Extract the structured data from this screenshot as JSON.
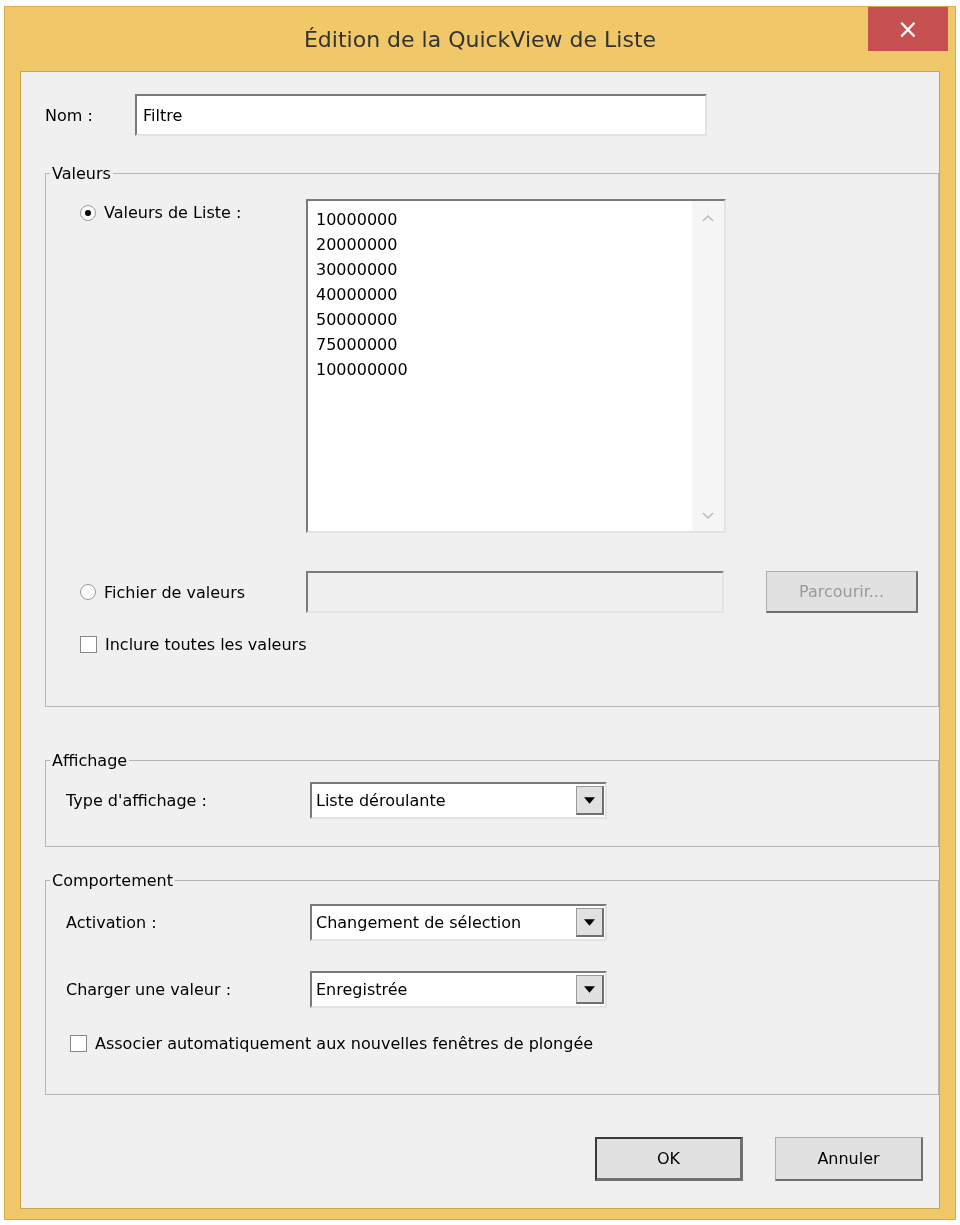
{
  "window": {
    "title": "Édition de la QuickView de Liste",
    "close": "×"
  },
  "name_field": {
    "label": "Nom :",
    "value": "Filtre"
  },
  "values_group": {
    "legend": "Valeurs",
    "options": [
      {
        "kind": "list",
        "label": "Valeurs de Liste :",
        "selected": true,
        "items": [
          "10000000",
          "20000000",
          "30000000",
          "40000000",
          "50000000",
          "75000000",
          "100000000"
        ]
      },
      {
        "kind": "file",
        "label": "Fichier de valeurs",
        "selected": false,
        "button": {
          "label": "Parcourir...",
          "disabled": true
        }
      }
    ],
    "include_all": {
      "label": "Inclure toutes les valeurs",
      "checked": false
    }
  },
  "display_group": {
    "legend": "Affichage",
    "fields": [
      {
        "label": "Type d'affichage :",
        "value": "Liste déroulante"
      }
    ]
  },
  "behavior_group": {
    "legend": "Comportement",
    "fields": [
      {
        "label": "Activation :",
        "value": "Changement de sélection"
      },
      {
        "label": "Charger une valeur :",
        "value": "Enregistrée"
      }
    ],
    "auto_associate": {
      "label": "Associer automatiquement aux nouvelles fenêtres de plongée",
      "checked": false
    }
  },
  "buttons": [
    {
      "label": "OK",
      "default": true
    },
    {
      "label": "Annuler",
      "default": false
    }
  ]
}
